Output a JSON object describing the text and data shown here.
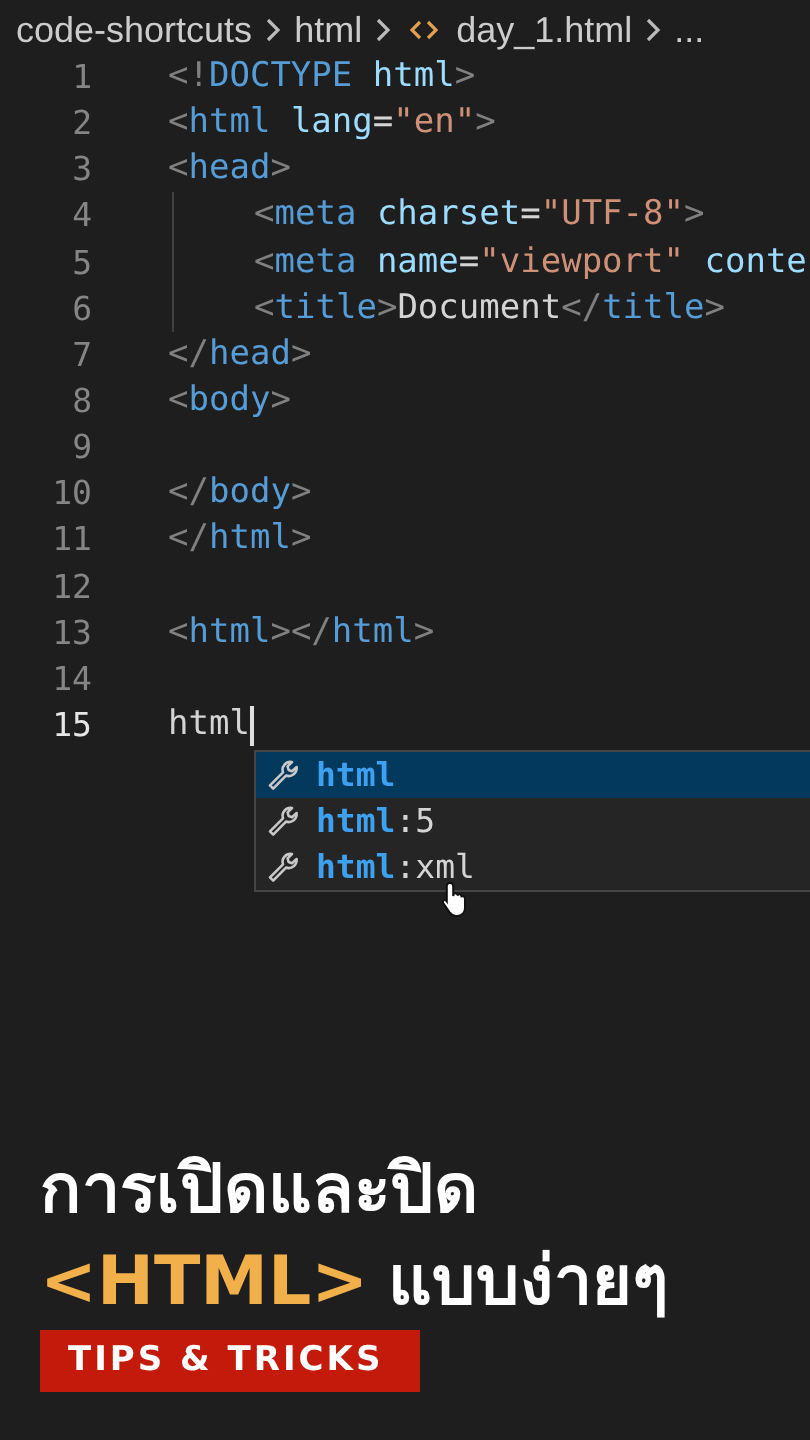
{
  "breadcrumb": {
    "items": [
      {
        "label": "code-shortcuts",
        "kind": "folder"
      },
      {
        "label": "html",
        "kind": "folder"
      },
      {
        "label": "day_1.html",
        "kind": "file"
      },
      {
        "label": "...",
        "kind": "more"
      }
    ]
  },
  "editor": {
    "lines": [
      {
        "number": "1",
        "current": false,
        "guide": false,
        "tokens": [
          {
            "kind": "punct",
            "text": "<!"
          },
          {
            "kind": "tag",
            "text": "DOCTYPE"
          },
          {
            "kind": "attr",
            "text": " html"
          },
          {
            "kind": "punct",
            "text": ">"
          }
        ]
      },
      {
        "number": "2",
        "current": false,
        "guide": false,
        "tokens": [
          {
            "kind": "punct",
            "text": "<"
          },
          {
            "kind": "tag",
            "text": "html"
          },
          {
            "kind": "attr",
            "text": " lang"
          },
          {
            "kind": "plain",
            "text": "="
          },
          {
            "kind": "string",
            "text": "\"en\""
          },
          {
            "kind": "punct",
            "text": ">"
          }
        ]
      },
      {
        "number": "3",
        "current": false,
        "guide": false,
        "tokens": [
          {
            "kind": "punct",
            "text": "<"
          },
          {
            "kind": "tag",
            "text": "head"
          },
          {
            "kind": "punct",
            "text": ">"
          }
        ]
      },
      {
        "number": "4",
        "current": false,
        "guide": true,
        "tokens": [
          {
            "kind": "punct",
            "text": "<"
          },
          {
            "kind": "tag",
            "text": "meta"
          },
          {
            "kind": "attr",
            "text": " charset"
          },
          {
            "kind": "plain",
            "text": "="
          },
          {
            "kind": "string",
            "text": "\"UTF-8\""
          },
          {
            "kind": "punct",
            "text": ">"
          }
        ]
      },
      {
        "number": "5",
        "current": false,
        "guide": true,
        "tokens": [
          {
            "kind": "punct",
            "text": "<"
          },
          {
            "kind": "tag",
            "text": "meta"
          },
          {
            "kind": "attr",
            "text": " name"
          },
          {
            "kind": "plain",
            "text": "="
          },
          {
            "kind": "string",
            "text": "\"viewport\""
          },
          {
            "kind": "attr",
            "text": " conte"
          }
        ]
      },
      {
        "number": "6",
        "current": false,
        "guide": true,
        "tokens": [
          {
            "kind": "punct",
            "text": "<"
          },
          {
            "kind": "tag",
            "text": "title"
          },
          {
            "kind": "punct",
            "text": ">"
          },
          {
            "kind": "plain",
            "text": "Document"
          },
          {
            "kind": "punct",
            "text": "</"
          },
          {
            "kind": "tag",
            "text": "title"
          },
          {
            "kind": "punct",
            "text": ">"
          }
        ]
      },
      {
        "number": "7",
        "current": false,
        "guide": false,
        "tokens": [
          {
            "kind": "punct",
            "text": "</"
          },
          {
            "kind": "tag",
            "text": "head"
          },
          {
            "kind": "punct",
            "text": ">"
          }
        ]
      },
      {
        "number": "8",
        "current": false,
        "guide": false,
        "tokens": [
          {
            "kind": "punct",
            "text": "<"
          },
          {
            "kind": "tag",
            "text": "body"
          },
          {
            "kind": "punct",
            "text": ">"
          }
        ]
      },
      {
        "number": "9",
        "current": false,
        "guide": false
      },
      {
        "number": "10",
        "current": false,
        "guide": false,
        "tokens": [
          {
            "kind": "punct",
            "text": "</"
          },
          {
            "kind": "tag",
            "text": "body"
          },
          {
            "kind": "punct",
            "text": ">"
          }
        ]
      },
      {
        "number": "11",
        "current": false,
        "guide": false,
        "tokens": [
          {
            "kind": "punct",
            "text": "</"
          },
          {
            "kind": "tag",
            "text": "html"
          },
          {
            "kind": "punct",
            "text": ">"
          }
        ]
      },
      {
        "number": "12",
        "current": false,
        "guide": false
      },
      {
        "number": "13",
        "current": false,
        "guide": false,
        "tokens": [
          {
            "kind": "punct",
            "text": "<"
          },
          {
            "kind": "tag",
            "text": "html"
          },
          {
            "kind": "punct",
            "text": "></"
          },
          {
            "kind": "tag",
            "text": "html"
          },
          {
            "kind": "punct",
            "text": ">"
          }
        ]
      },
      {
        "number": "14",
        "current": false,
        "guide": false
      },
      {
        "number": "15",
        "current": true,
        "guide": false,
        "tokens": [
          {
            "kind": "plain",
            "text": "html"
          }
        ]
      }
    ],
    "suggestions": [
      {
        "match": "html",
        "selected": true
      },
      {
        "match": "html",
        "rest": ":5",
        "selected": false
      },
      {
        "match": "html",
        "rest": ":xml",
        "selected": false
      }
    ]
  },
  "caption": {
    "lines": [
      [
        {
          "kind": "plain",
          "text": "การเปิดและปิด"
        }
      ],
      [
        {
          "kind": "highlight",
          "text": "<HTML>"
        },
        {
          "kind": "plain",
          "text": "แบบง่ายๆ"
        }
      ]
    ],
    "badge": "TIPS & TRICKS"
  }
}
